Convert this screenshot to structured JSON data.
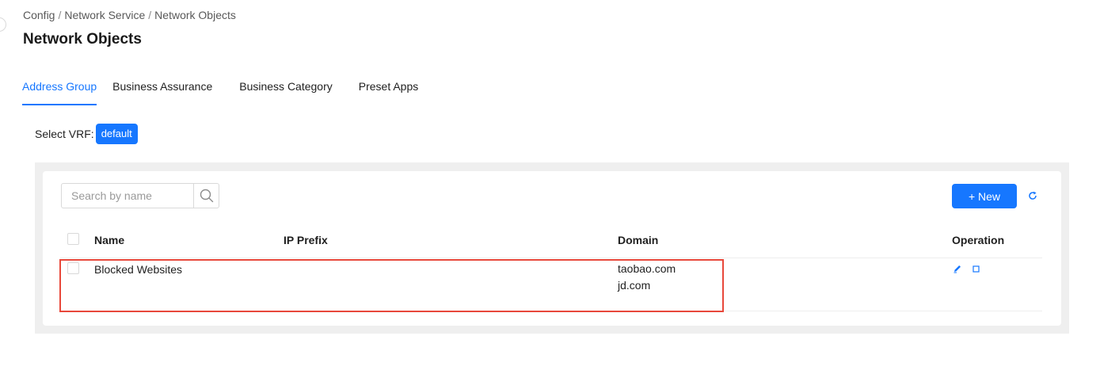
{
  "breadcrumb": [
    "Config",
    "Network Service",
    "Network Objects"
  ],
  "page_title": "Network Objects",
  "tabs": [
    {
      "label": "Address Group",
      "active": true
    },
    {
      "label": "Business Assurance",
      "active": false
    },
    {
      "label": "Business Category",
      "active": false
    },
    {
      "label": "Preset Apps",
      "active": false
    }
  ],
  "vrf": {
    "label": "Select VRF:",
    "value": "default"
  },
  "toolbar": {
    "search_placeholder": "Search by name",
    "search_value": "",
    "new_label": "+ New",
    "search_icon": "search-icon",
    "refresh_icon": "refresh-icon"
  },
  "table": {
    "columns": [
      "Name",
      "IP Prefix",
      "Domain",
      "Operation"
    ],
    "rows": [
      {
        "name": "Blocked Websites",
        "ip_prefix": "",
        "domains": [
          "taobao.com",
          "jd.com"
        ],
        "operations": [
          "edit-icon",
          "delete-icon"
        ]
      }
    ]
  },
  "colors": {
    "accent": "#1677ff",
    "highlight_border": "#e8483b",
    "panel_bg": "#efefef"
  }
}
